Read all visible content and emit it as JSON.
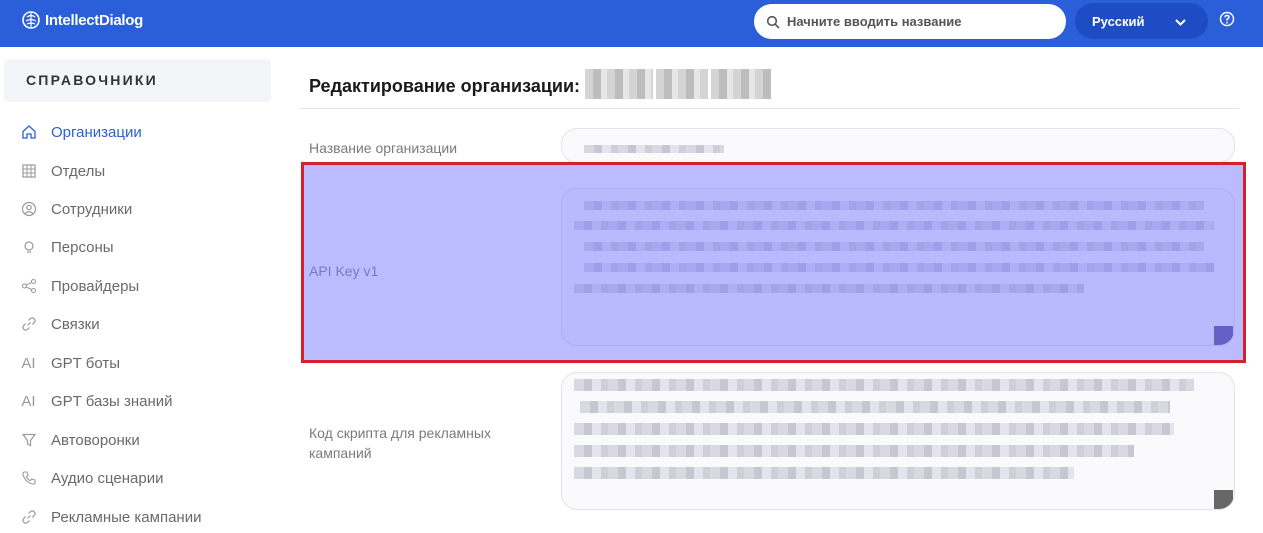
{
  "app": {
    "logo_text": "IntellectDialog"
  },
  "header": {
    "search_placeholder": "Начните вводить название",
    "language": "Русский",
    "icons": [
      "brain-logo-icon",
      "search-icon",
      "chevron-down-icon",
      "help-icon"
    ]
  },
  "sidebar": {
    "heading": "СПРАВОЧНИКИ",
    "items": [
      {
        "label": "Организации",
        "icon": "home-icon",
        "active": true
      },
      {
        "label": "Отделы",
        "icon": "grid-icon",
        "active": false
      },
      {
        "label": "Сотрудники",
        "icon": "user-circle-icon",
        "active": false
      },
      {
        "label": "Персоны",
        "icon": "person-icon",
        "active": false
      },
      {
        "label": "Провайдеры",
        "icon": "share-icon",
        "active": false
      },
      {
        "label": "Связки",
        "icon": "link-icon",
        "active": false
      },
      {
        "label": "GPT боты",
        "icon": "ai-icon",
        "active": false
      },
      {
        "label": "GPT базы знаний",
        "icon": "ai-icon",
        "active": false
      },
      {
        "label": "Автоворонки",
        "icon": "funnel-icon",
        "active": false
      },
      {
        "label": "Аудио сценарии",
        "icon": "phone-icon",
        "active": false
      },
      {
        "label": "Рекламные кампании",
        "icon": "link-icon",
        "active": false
      }
    ]
  },
  "main": {
    "title": "Редактирование организации:",
    "fields": [
      {
        "label": "Название организации"
      },
      {
        "label": "API Key v1"
      },
      {
        "label": "Код скрипта для рекламных кампаний"
      }
    ]
  },
  "colors": {
    "header_bg": "#2b5fd9",
    "language_bg": "#1d4cc4",
    "active_item": "#2b5fd9",
    "highlight_border": "#d8202a",
    "highlight_fill": "#7878ff"
  }
}
